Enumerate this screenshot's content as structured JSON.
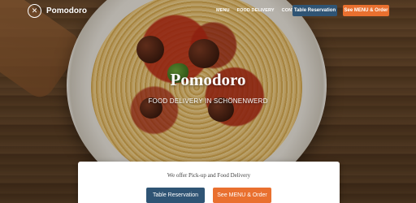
{
  "brand": {
    "name": "Pomodoro",
    "logo_icon": "fork-knife-icon"
  },
  "nav": {
    "items": [
      {
        "label": "MENU"
      },
      {
        "label": "FOOD DELIVERY"
      },
      {
        "label": "CONTACT US"
      }
    ],
    "reserve_label": "Table Reservation",
    "menu_order_label": "See MENU & Order"
  },
  "hero": {
    "title": "Pomodoro",
    "subtitle": "FOOD DELIVERY IN SCHÖNENWERD"
  },
  "card": {
    "text": "We offer Pick-up and Food Delivery",
    "reserve_label": "Table Reservation",
    "menu_order_label": "See MENU & Order"
  },
  "colors": {
    "primary_blue": "#2f5474",
    "accent_orange": "#e9702f"
  }
}
